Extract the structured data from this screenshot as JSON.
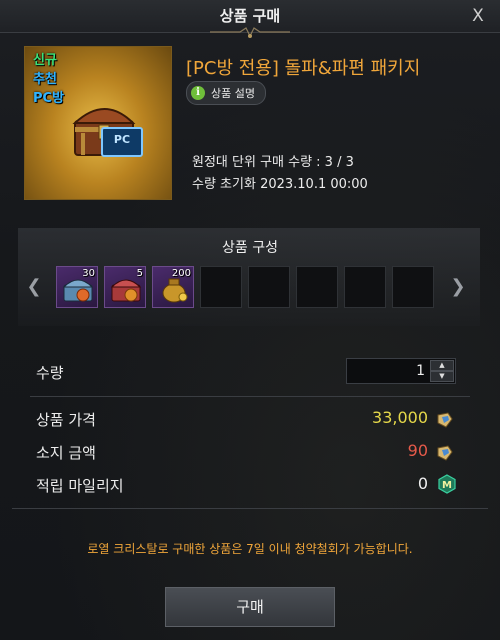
{
  "window": {
    "title": "상품 구매",
    "close_label": "X"
  },
  "product": {
    "badge_new": "신규",
    "badge_recommend": "추천",
    "badge_pcbang": "PC방",
    "pc_tag": "PC",
    "title": "[PC방 전용] 돌파&파편 패키지",
    "desc_button": "상품 설명",
    "purchase_limit": "원정대 단위 구매 수량 : 3 / 3",
    "reset_date": "수량 초기화 2023.10.1 00:00"
  },
  "composition": {
    "title": "상품 구성",
    "slots": [
      {
        "count": "30",
        "icon": "chest-purple-icon"
      },
      {
        "count": "5",
        "icon": "chest-red-icon"
      },
      {
        "count": "200",
        "icon": "gold-pouch-icon"
      },
      {
        "count": "",
        "icon": ""
      },
      {
        "count": "",
        "icon": ""
      },
      {
        "count": "",
        "icon": ""
      },
      {
        "count": "",
        "icon": ""
      },
      {
        "count": "",
        "icon": ""
      }
    ]
  },
  "quantity": {
    "label": "수량",
    "value": "1"
  },
  "price": {
    "label": "상품 가격",
    "value": "33,000"
  },
  "owned": {
    "label": "소지 금액",
    "value": "90"
  },
  "mileage": {
    "label": "적립 마일리지",
    "value": "0"
  },
  "notice": "로열 크리스탈로 구매한 상품은 7일 이내 청약철회가 가능합니다.",
  "buy_button": "구매",
  "colors": {
    "accent_orange": "#f0a63a",
    "price_yellow": "#e5d84a",
    "owned_red": "#e55a4a"
  }
}
